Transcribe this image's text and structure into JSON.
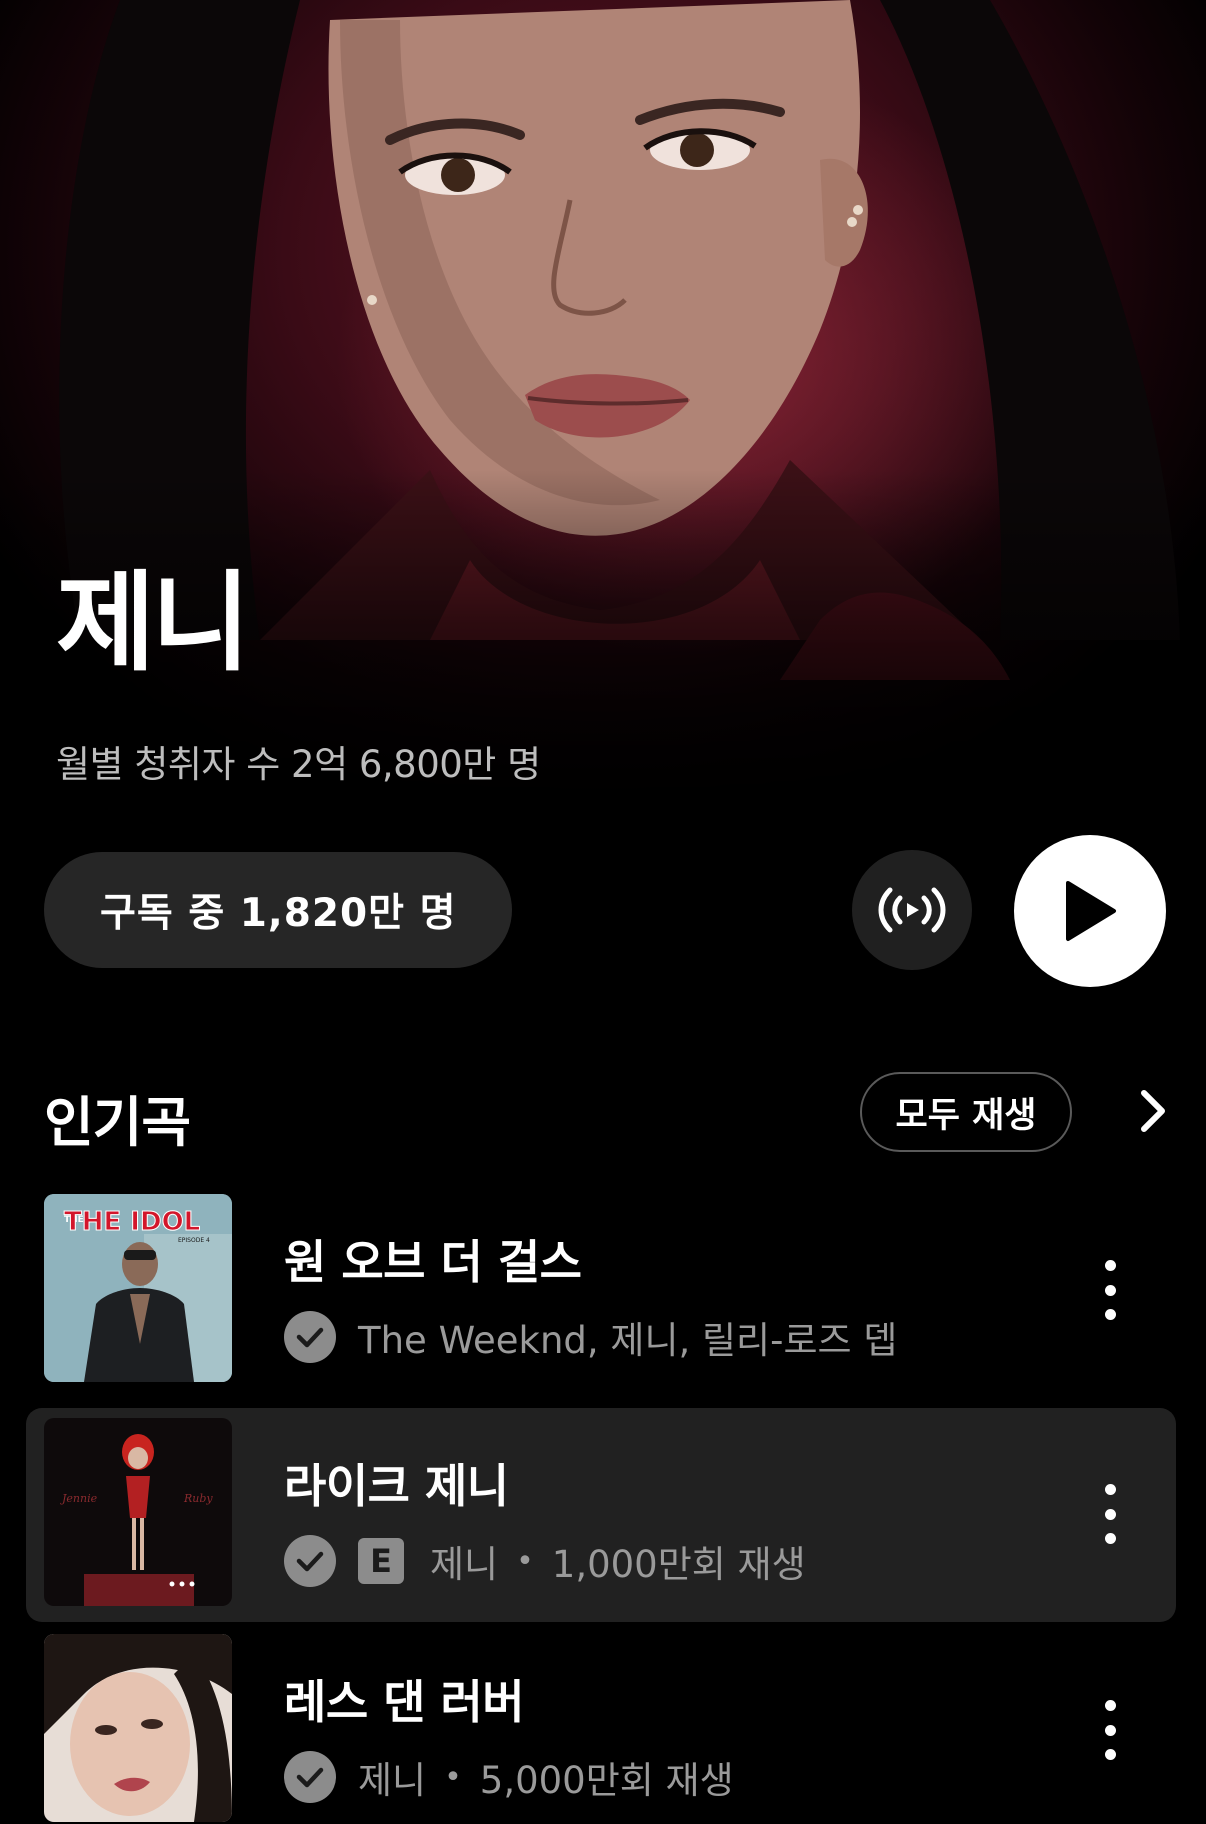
{
  "artist": {
    "name": "제니",
    "monthly_listeners": "월별 청취자 수 2억 6,800만 명"
  },
  "actions": {
    "subscribe_label": "구독 중  1,820만 명",
    "radio_icon": "radio-broadcast-icon",
    "play_icon": "play-icon"
  },
  "popular": {
    "title": "인기곡",
    "play_all_label": "모두 재생",
    "tracks": [
      {
        "title": "원 오브 더 걸스",
        "artists": "The Weeknd, 제니, 릴리-로즈 뎁",
        "explicit": false,
        "plays": "",
        "thumb_text": "THE IDOL",
        "thumb_text_small": "THE",
        "thumb_sub": "EPISODE 4"
      },
      {
        "title": "라이크 제니",
        "artists": "제니",
        "explicit": true,
        "explicit_label": "E",
        "plays": "1,000만회 재생",
        "thumb_left": "Jennie",
        "thumb_right": "Ruby"
      },
      {
        "title": "레스 댄 러버",
        "artists": "제니",
        "explicit": false,
        "plays": "5,000만회 재생"
      }
    ]
  },
  "colors": {
    "background": "#000000",
    "hero_red": "#5e1524",
    "pill_bg": "#262626",
    "active_row": "#212121",
    "secondary_text": "#9a9a9a"
  }
}
